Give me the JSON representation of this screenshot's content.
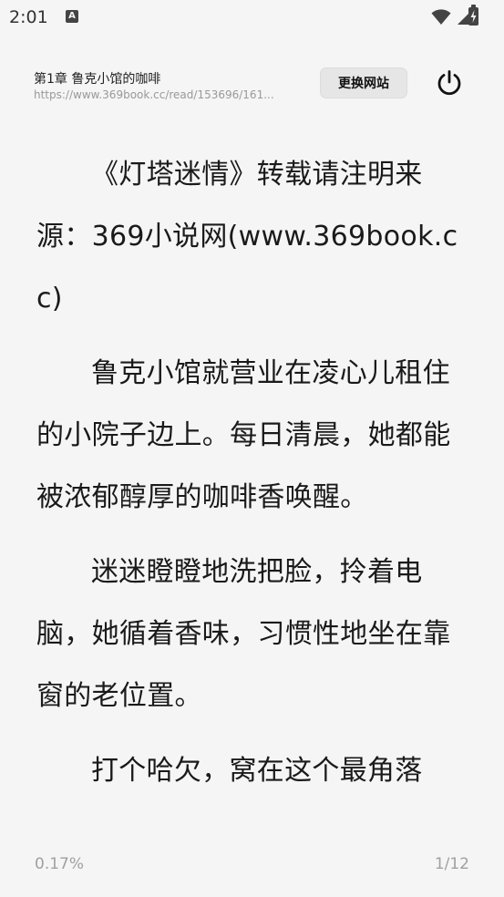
{
  "status_bar": {
    "time": "2:01",
    "notification_icon": "a-app-icon",
    "icons": [
      "wifi-icon",
      "signal-icon",
      "battery-charging-icon"
    ]
  },
  "header": {
    "chapter_title": "第1章 鲁克小馆的咖啡",
    "url": "https://www.369book.cc/read/153696/161...",
    "switch_site_label": "更换网站",
    "power_icon": "power-icon"
  },
  "content": {
    "paragraphs": [
      "《灯塔迷情》转载请注明来源：369小说网(www.369book.cc)",
      "鲁克小馆就营业在凌心儿租住的小院子边上。每日清晨，她都能被浓郁醇厚的咖啡香唤醒。",
      "迷迷瞪瞪地洗把脸，拎着电脑，她循着香味，习惯性地坐在靠窗的老位置。",
      "打个哈欠，窝在这个最角落"
    ]
  },
  "footer": {
    "progress": "0.17%",
    "page": "1/12"
  },
  "colors": {
    "background": "#f5f5f5",
    "text": "#1a1a1a",
    "muted": "#a0a0a0"
  }
}
